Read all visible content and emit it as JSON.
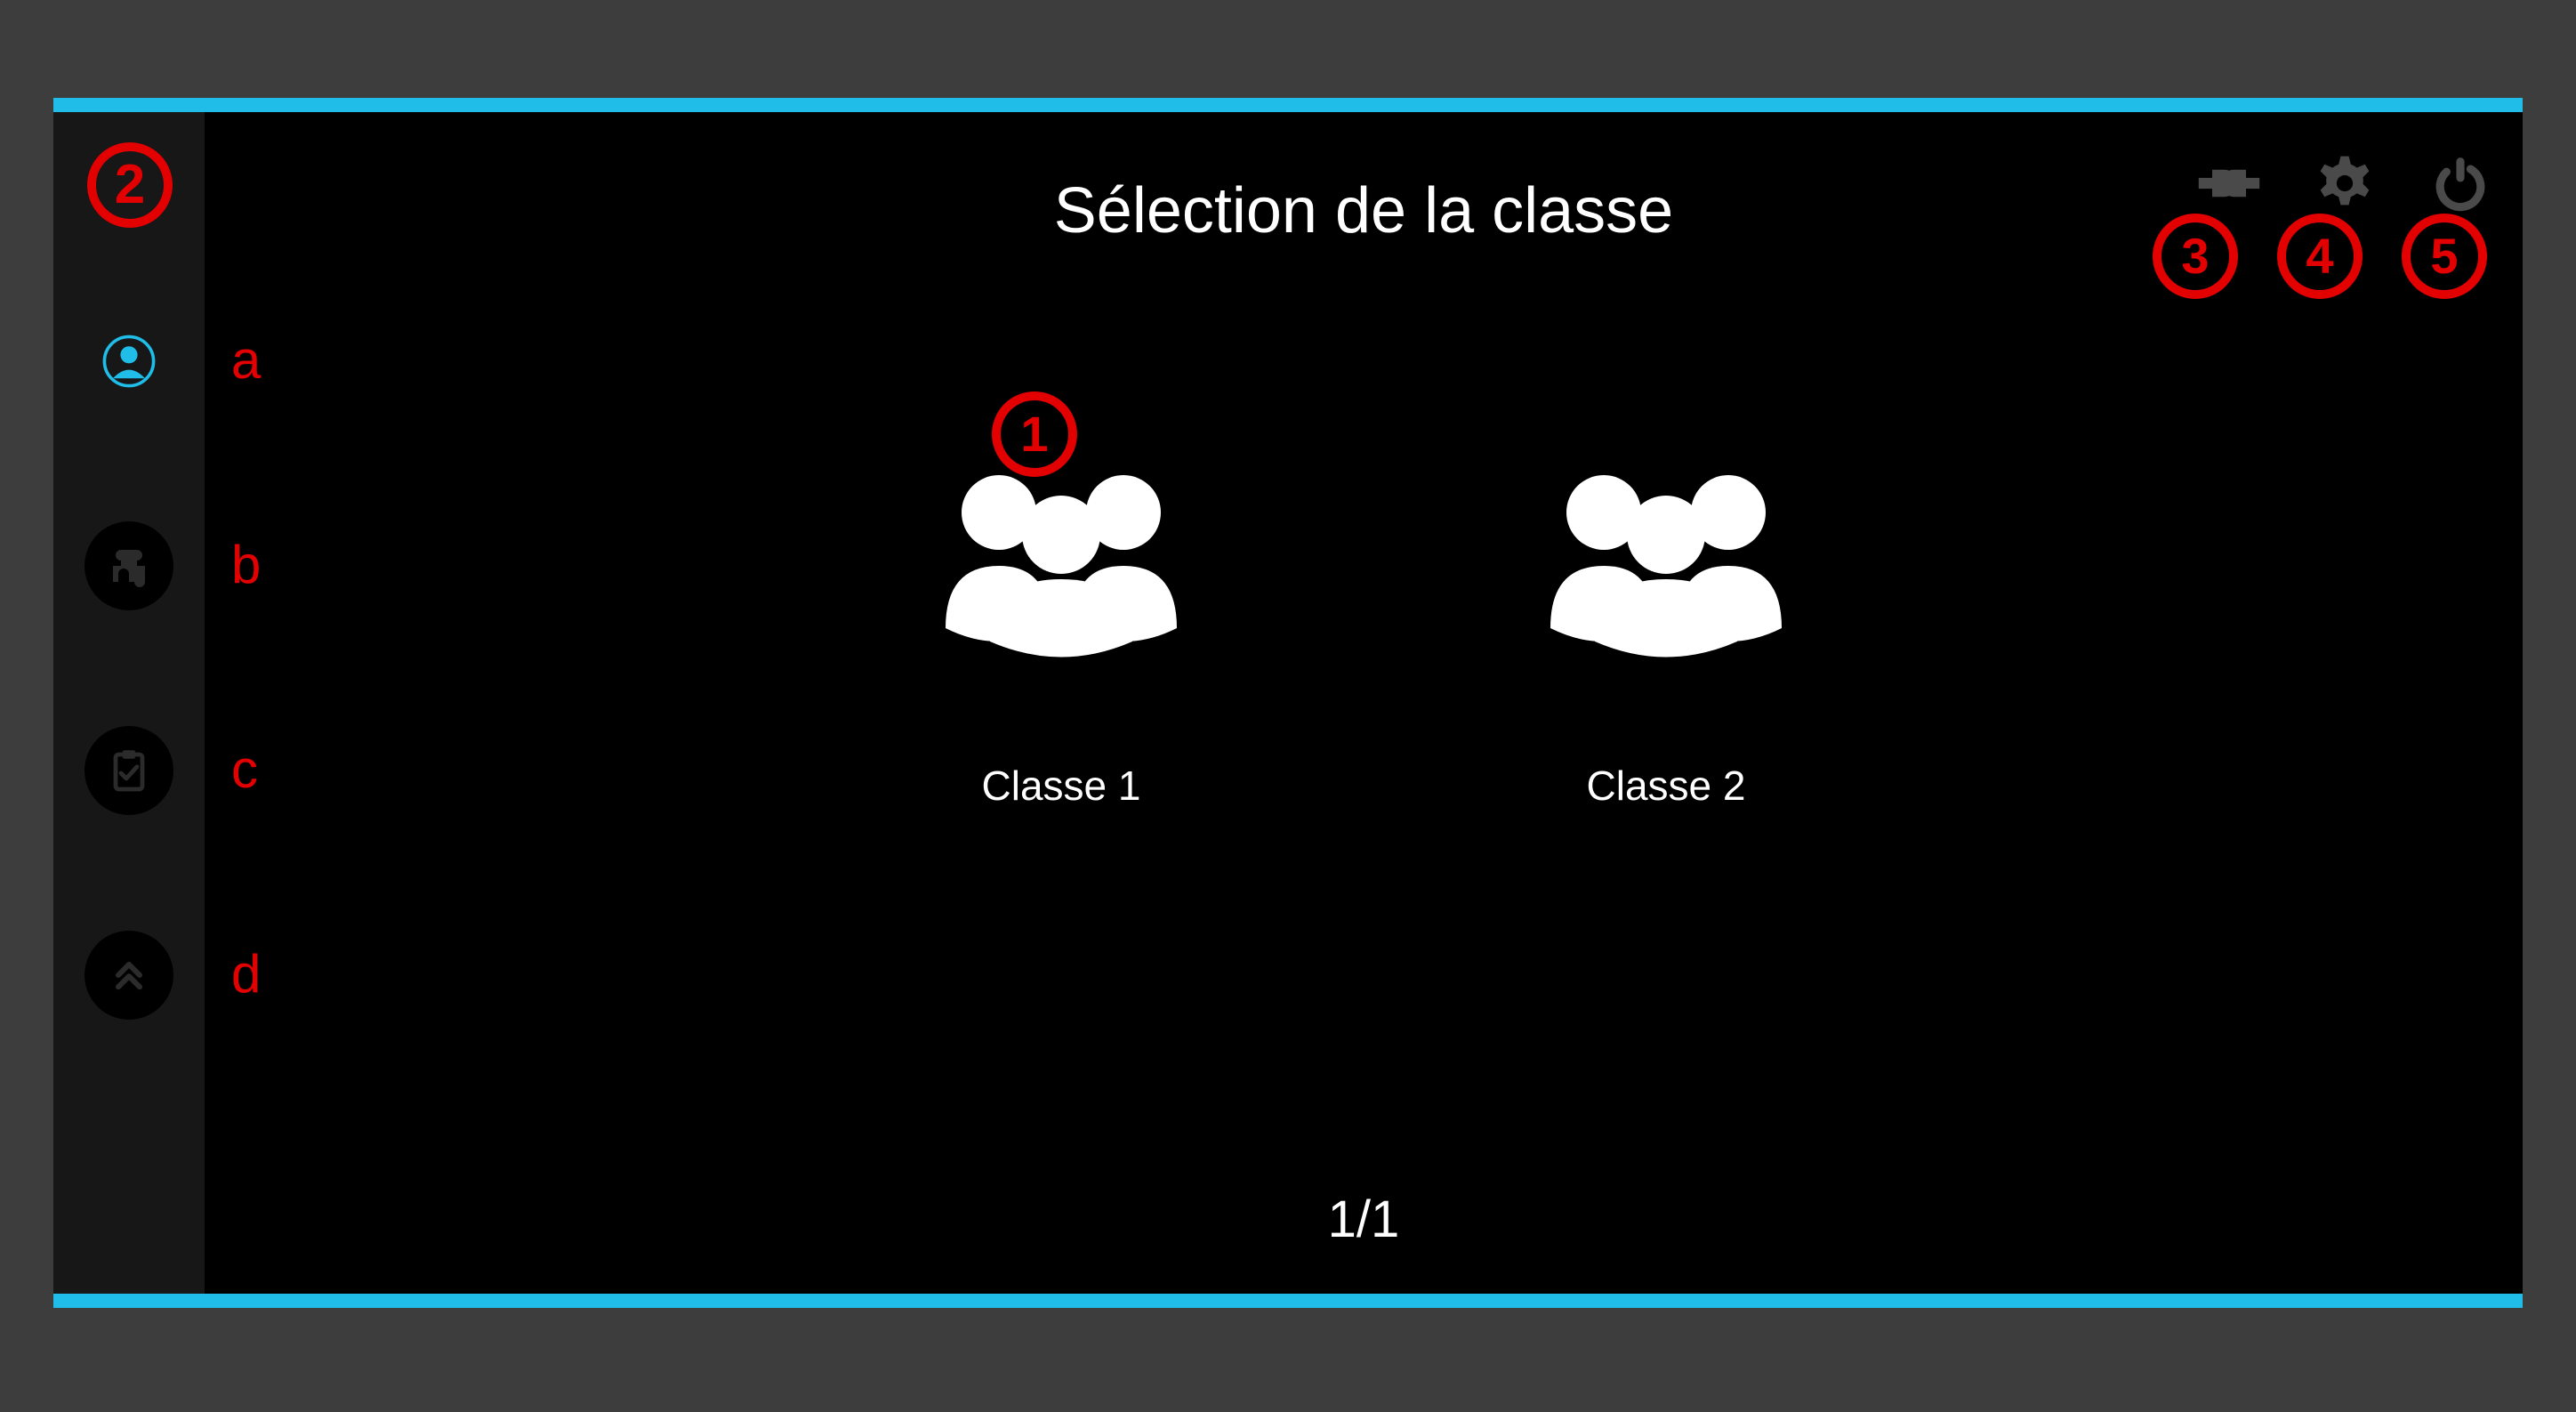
{
  "title": "Sélection de la classe",
  "pager": "1/1",
  "classes": [
    {
      "label": "Classe 1"
    },
    {
      "label": "Classe 2"
    }
  ],
  "sidebar": {
    "items": [
      {
        "name": "user",
        "letter": "a",
        "active": true
      },
      {
        "name": "puzzle",
        "letter": "b",
        "active": false
      },
      {
        "name": "clipboard",
        "letter": "c",
        "active": false
      },
      {
        "name": "up",
        "letter": "d",
        "active": false
      }
    ]
  },
  "toolbar": {
    "items": [
      {
        "name": "plug"
      },
      {
        "name": "gear"
      },
      {
        "name": "power"
      }
    ]
  },
  "annotations": {
    "numbers": [
      "①",
      "②",
      "③",
      "④",
      "⑤"
    ],
    "main_class_marker": "①",
    "sidebar_marker": "②",
    "toolbar_markers": [
      "③",
      "④",
      "⑤"
    ]
  }
}
